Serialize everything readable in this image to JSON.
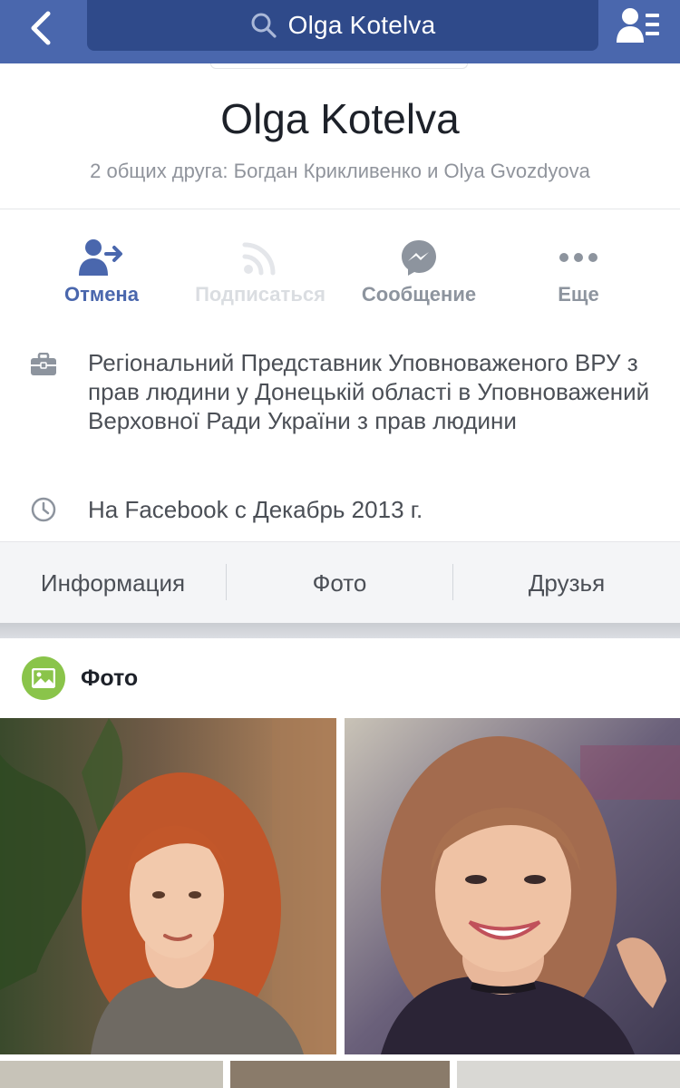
{
  "navbar": {
    "search_text": "Olga Kotelva",
    "back_icon": "chevron-left-icon",
    "search_icon": "search-icon",
    "friends_icon": "friend-requests-icon",
    "bar_color": "#4a67ad",
    "search_bg": "#2f4a8a"
  },
  "profile": {
    "name": "Olga Kotelva",
    "mutual_friends": "2 общих друга: Богдан Крикливенко и Olya Gvozdyova"
  },
  "actions": [
    {
      "label": "Отмена",
      "icon": "unfriend-icon",
      "state": "active"
    },
    {
      "label": "Подписаться",
      "icon": "rss-icon",
      "state": "disabled"
    },
    {
      "label": "Сообщение",
      "icon": "messenger-icon",
      "state": "normal"
    },
    {
      "label": "Еще",
      "icon": "more-dots-icon",
      "state": "normal"
    }
  ],
  "info": {
    "work": "Регіональний Представник Уповноваженого ВРУ з прав людини у Донецькій області в Уповноважений Верховної Ради України з прав людини",
    "since": "На Facebook с Декабрь 2013 г."
  },
  "tabs": [
    {
      "label": "Информация"
    },
    {
      "label": "Фото"
    },
    {
      "label": "Друзья"
    }
  ],
  "photos": {
    "title": "Фото",
    "badge_color": "#8ac44a"
  }
}
